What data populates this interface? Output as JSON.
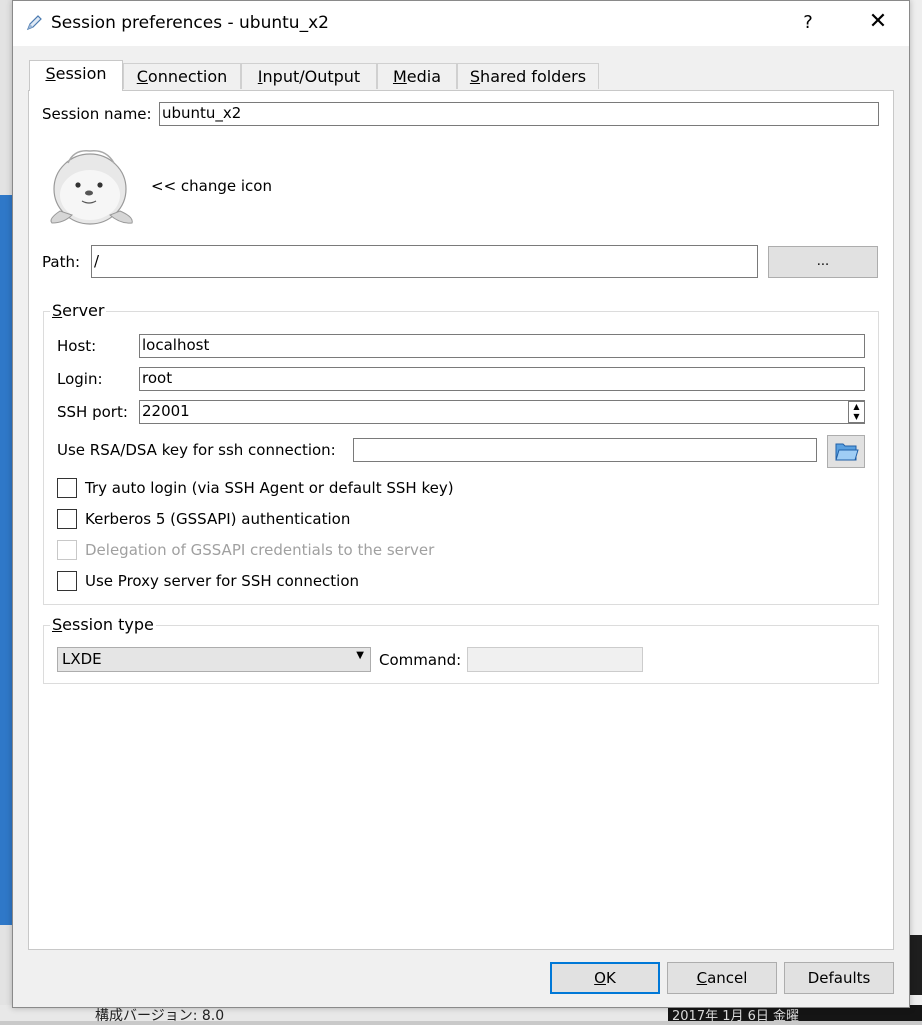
{
  "window": {
    "title": "Session preferences - ubuntu_x2",
    "help_label": "?",
    "close_label": "✕"
  },
  "tabs": [
    {
      "label": "Session",
      "mnemonic": "S",
      "rest": "ession"
    },
    {
      "label": "Connection",
      "mnemonic": "C",
      "rest": "onnection"
    },
    {
      "label": "Input/Output",
      "mnemonic": "I",
      "rest": "nput/Output"
    },
    {
      "label": "Media",
      "mnemonic": "M",
      "rest": "edia"
    },
    {
      "label": "Shared folders",
      "mnemonic": "S",
      "rest": "hared folders"
    }
  ],
  "session": {
    "name_label": "Session name:",
    "name_value": "ubuntu_x2",
    "change_icon_label": "<< change icon",
    "path_label": "Path:",
    "path_value": "/",
    "browse_label": "..."
  },
  "server": {
    "group_mnemonic": "S",
    "group_rest": "erver",
    "host_label": "Host:",
    "host_value": "localhost",
    "login_label": "Login:",
    "login_value": "root",
    "port_label": "SSH port:",
    "port_value": "22001",
    "key_label": "Use RSA/DSA key for ssh connection:",
    "key_value": "",
    "checkboxes": [
      {
        "label": "Try auto login (via SSH Agent or default SSH key)"
      },
      {
        "label": "Kerberos 5 (GSSAPI) authentication"
      },
      {
        "label": "Delegation of GSSAPI credentials to the server"
      },
      {
        "label": "Use Proxy server for SSH connection"
      }
    ]
  },
  "session_type": {
    "group_mnemonic": "S",
    "group_rest": "ession type",
    "selected": "LXDE",
    "command_label": "Command:",
    "command_value": ""
  },
  "buttons": {
    "ok_mnemonic": "O",
    "ok_rest": "K",
    "cancel_mnemonic": "C",
    "cancel_rest": "ancel",
    "defaults_label": "Defaults"
  },
  "background": {
    "bottom_text": "構成バージョン: 8.0",
    "bottom_right_text": "2017年 1月 6日 金曜"
  },
  "colors": {
    "accent": "#0078d7",
    "panel_bg": "#ffffff",
    "dialog_bg": "#f0f0f0"
  }
}
